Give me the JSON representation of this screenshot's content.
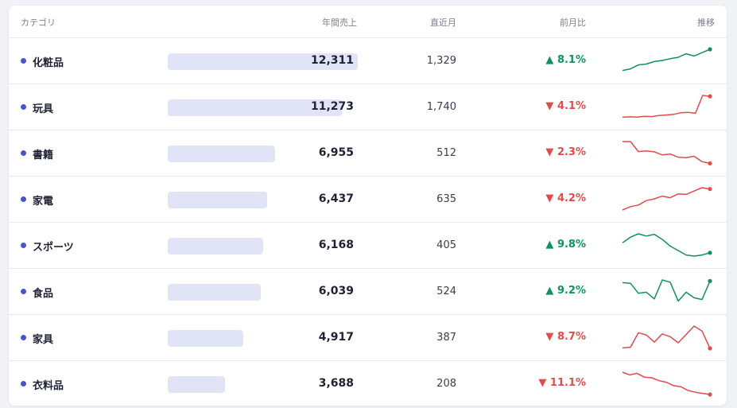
{
  "header": {
    "category": "カテゴリ",
    "annual_sales": "年間売上",
    "recent_month": "直近月",
    "mom": "前月比",
    "trend": "推移"
  },
  "colors": {
    "up": "#12915a",
    "down": "#e04c4c",
    "bar": "#e1e3f7",
    "dot": "#4a55c8"
  },
  "rows": [
    {
      "name": "化粧品",
      "annual": "12,311",
      "annual_value": 12311,
      "recent": "1,329",
      "mom": "▲ 8.1%",
      "direction": "up",
      "trend": [
        0.05,
        0.12,
        0.3,
        0.34,
        0.45,
        0.5,
        0.58,
        0.64,
        0.8,
        0.7,
        0.85,
        1.0
      ]
    },
    {
      "name": "玩具",
      "annual": "11,273",
      "annual_value": 11273,
      "recent": "1,740",
      "mom": "▼ 4.1%",
      "direction": "down",
      "trend": [
        0.02,
        0.04,
        0.03,
        0.06,
        0.05,
        0.1,
        0.12,
        0.15,
        0.22,
        0.24,
        0.2,
        1.0,
        0.96
      ]
    },
    {
      "name": "書籍",
      "annual": "6,955",
      "annual_value": 6955,
      "recent": "512",
      "mom": "▼ 2.3%",
      "direction": "down",
      "trend": [
        1.0,
        1.0,
        0.55,
        0.58,
        0.54,
        0.4,
        0.44,
        0.3,
        0.28,
        0.34,
        0.1,
        0.02
      ]
    },
    {
      "name": "家電",
      "annual": "6,437",
      "annual_value": 6437,
      "recent": "635",
      "mom": "▼ 4.2%",
      "direction": "down",
      "trend": [
        0.0,
        0.15,
        0.22,
        0.42,
        0.5,
        0.62,
        0.55,
        0.72,
        0.7,
        0.85,
        1.0,
        0.94
      ]
    },
    {
      "name": "スポーツ",
      "annual": "6,168",
      "annual_value": 6168,
      "recent": "405",
      "mom": "▲ 9.8%",
      "direction": "up",
      "trend": [
        0.6,
        0.85,
        1.0,
        0.9,
        0.98,
        0.75,
        0.45,
        0.25,
        0.05,
        0.0,
        0.05,
        0.15
      ]
    },
    {
      "name": "食品",
      "annual": "6,039",
      "annual_value": 6039,
      "recent": "524",
      "mom": "▲ 9.2%",
      "direction": "up",
      "trend": [
        0.88,
        0.85,
        0.4,
        0.45,
        0.15,
        1.0,
        0.9,
        0.05,
        0.45,
        0.2,
        0.12,
        0.95
      ]
    },
    {
      "name": "家具",
      "annual": "4,917",
      "annual_value": 4917,
      "recent": "387",
      "mom": "▼ 8.7%",
      "direction": "down",
      "trend": [
        0.02,
        0.05,
        0.7,
        0.6,
        0.28,
        0.65,
        0.52,
        0.25,
        0.62,
        1.0,
        0.78,
        0.0
      ]
    },
    {
      "name": "衣料品",
      "annual": "3,688",
      "annual_value": 3688,
      "recent": "208",
      "mom": "▼ 11.1%",
      "direction": "down",
      "trend": [
        1.0,
        0.88,
        0.95,
        0.78,
        0.75,
        0.62,
        0.55,
        0.4,
        0.35,
        0.18,
        0.1,
        0.05,
        0.0
      ]
    }
  ]
}
